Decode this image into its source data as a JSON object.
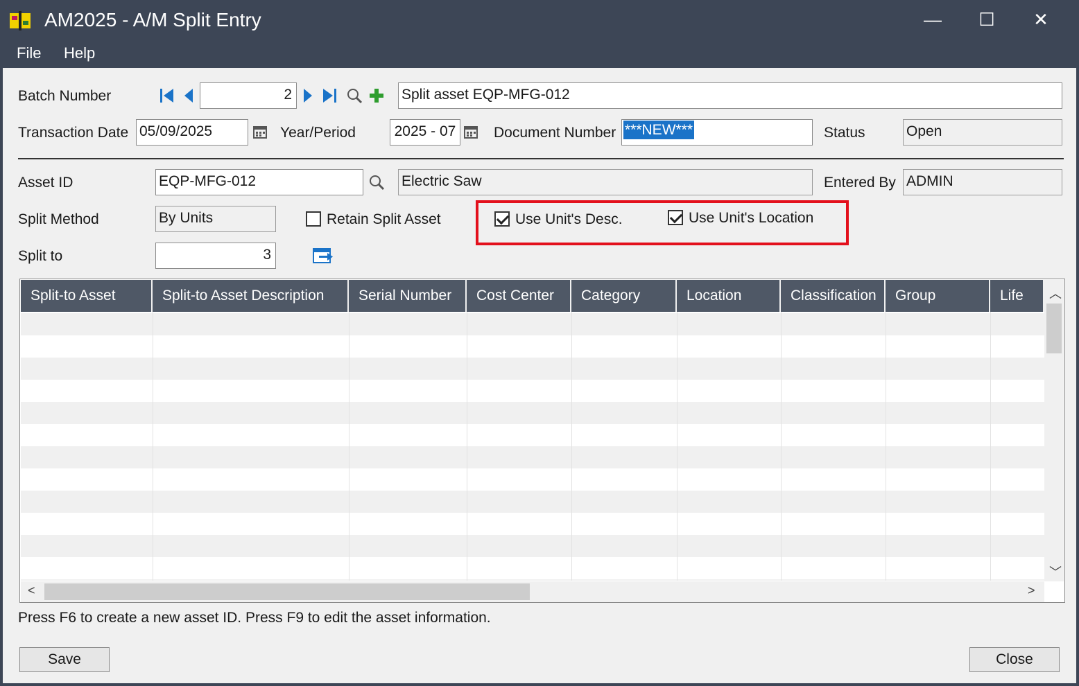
{
  "window": {
    "title": "AM2025 - A/M Split Entry",
    "minimize": "—",
    "maximize": "☐",
    "close": "✕"
  },
  "menu": {
    "file": "File",
    "help": "Help"
  },
  "batch": {
    "label": "Batch Number",
    "value": "2",
    "description": "Split asset EQP-MFG-012"
  },
  "transaction": {
    "date_label": "Transaction Date",
    "date_value": "05/09/2025",
    "year_period_label": "Year/Period",
    "year_period_value": "2025 - 07",
    "doc_label": "Document Number",
    "doc_value": "***NEW***",
    "status_label": "Status",
    "status_value": "Open"
  },
  "asset": {
    "id_label": "Asset ID",
    "id_value": "EQP-MFG-012",
    "description": "Electric Saw",
    "entered_by_label": "Entered By",
    "entered_by_value": "ADMIN"
  },
  "split": {
    "method_label": "Split Method",
    "method_value": "By Units",
    "retain_label": "Retain Split Asset",
    "retain_checked": false,
    "use_desc_label": "Use Unit's Desc.",
    "use_desc_checked": true,
    "use_location_label": "Use Unit's Location",
    "use_location_checked": true,
    "to_label": "Split to",
    "to_value": "3"
  },
  "grid": {
    "columns": [
      "Split-to Asset",
      "Split-to Asset Description",
      "Serial Number",
      "Cost Center",
      "Category",
      "Location",
      "Classification",
      "Group",
      "Life"
    ],
    "rows": []
  },
  "hint": "Press F6 to create a new asset ID. Press F9 to edit the asset information.",
  "buttons": {
    "save": "Save",
    "close": "Close"
  },
  "colors": {
    "titlebar": "#3d4656",
    "grid_header": "#4f5866",
    "highlight": "#e3101c",
    "nav_arrows": "#1a73c8",
    "add_icon": "#2e9d2e"
  }
}
